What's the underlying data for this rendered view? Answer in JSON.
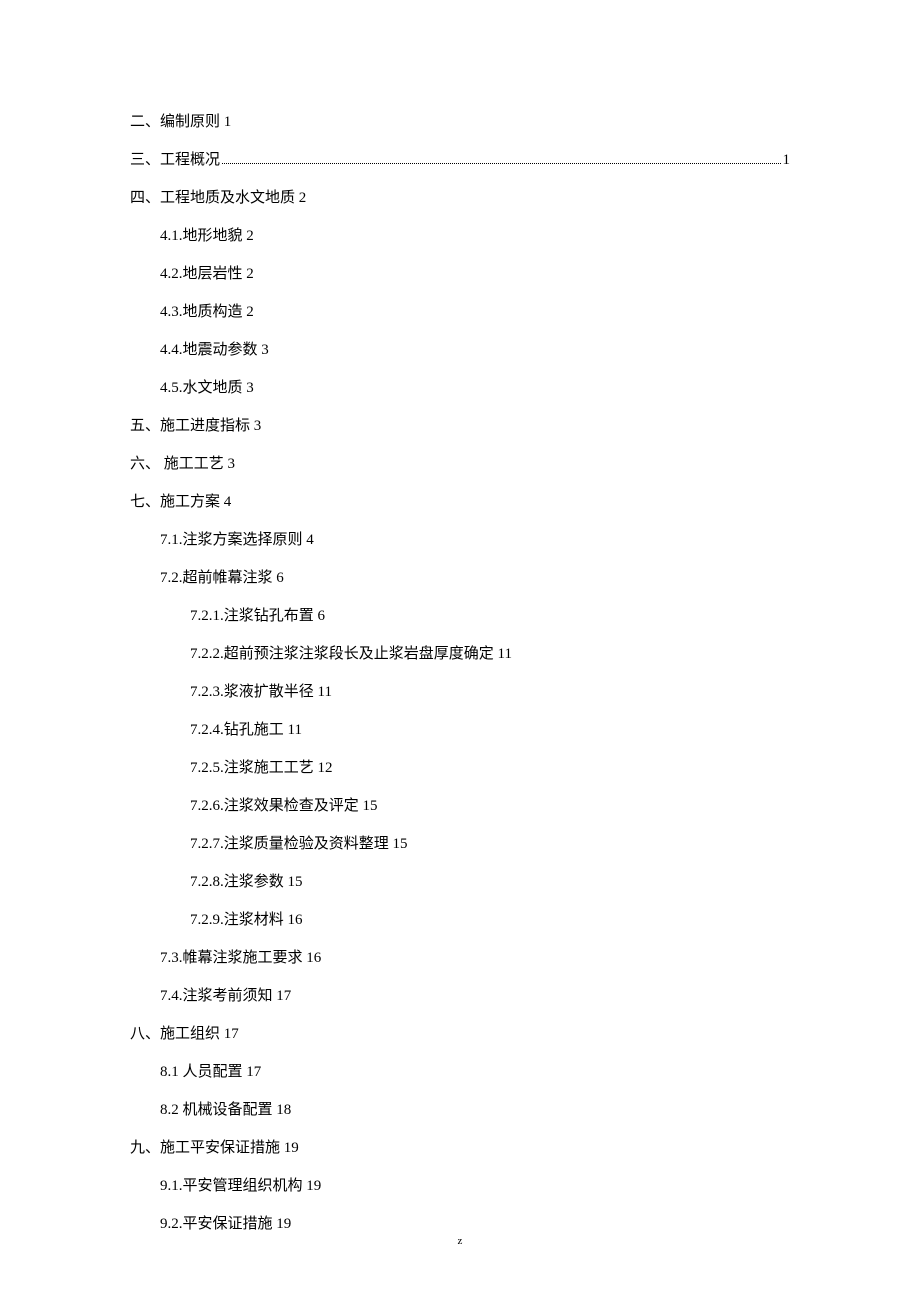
{
  "toc": [
    {
      "level": 0,
      "text": "二、编制原则 1",
      "dotted": false
    },
    {
      "level": 0,
      "text_before": "三、工程概况",
      "text_after": "1",
      "dotted": true
    },
    {
      "level": 0,
      "text": "四、工程地质及水文地质 2",
      "dotted": false
    },
    {
      "level": 1,
      "text": "4.1.地形地貌 2",
      "dotted": false
    },
    {
      "level": 1,
      "text": "4.2.地层岩性 2",
      "dotted": false
    },
    {
      "level": 1,
      "text": "4.3.地质构造 2",
      "dotted": false
    },
    {
      "level": 1,
      "text": "4.4.地震动参数 3",
      "dotted": false
    },
    {
      "level": 1,
      "text": "4.5.水文地质 3",
      "dotted": false
    },
    {
      "level": 0,
      "text": "五、施工进度指标 3",
      "dotted": false
    },
    {
      "level": 0,
      "text": "六、 施工工艺 3",
      "dotted": false
    },
    {
      "level": 0,
      "text": "七、施工方案 4",
      "dotted": false
    },
    {
      "level": 1,
      "text": "7.1.注浆方案选择原则 4",
      "dotted": false
    },
    {
      "level": 1,
      "text": "7.2.超前帷幕注浆 6",
      "dotted": false
    },
    {
      "level": 2,
      "text": "7.2.1.注浆钻孔布置 6",
      "dotted": false
    },
    {
      "level": 2,
      "text": "7.2.2.超前预注浆注浆段长及止浆岩盘厚度确定 11",
      "dotted": false
    },
    {
      "level": 2,
      "text": "7.2.3.浆液扩散半径 11",
      "dotted": false
    },
    {
      "level": 2,
      "text": "7.2.4.钻孔施工 11",
      "dotted": false
    },
    {
      "level": 2,
      "text": "7.2.5.注浆施工工艺 12",
      "dotted": false
    },
    {
      "level": 2,
      "text": "7.2.6.注浆效果检查及评定 15",
      "dotted": false
    },
    {
      "level": 2,
      "text": "7.2.7.注浆质量检验及资料整理 15",
      "dotted": false
    },
    {
      "level": 2,
      "text": "7.2.8.注浆参数 15",
      "dotted": false
    },
    {
      "level": 2,
      "text": "7.2.9.注浆材料 16",
      "dotted": false
    },
    {
      "level": 1,
      "text": "7.3.帷幕注浆施工要求 16",
      "dotted": false
    },
    {
      "level": 1,
      "text": "7.4.注浆考前须知 17",
      "dotted": false
    },
    {
      "level": 0,
      "text": "八、施工组织 17",
      "dotted": false
    },
    {
      "level": 1,
      "text": "8.1 人员配置 17",
      "dotted": false
    },
    {
      "level": 1,
      "text": "8.2 机械设备配置 18",
      "dotted": false
    },
    {
      "level": 0,
      "text": "九、施工平安保证措施 19",
      "dotted": false
    },
    {
      "level": 1,
      "text": "9.1.平安管理组织机构 19",
      "dotted": false
    },
    {
      "level": 1,
      "text": "9.2.平安保证措施 19",
      "dotted": false
    }
  ],
  "footer": "z"
}
